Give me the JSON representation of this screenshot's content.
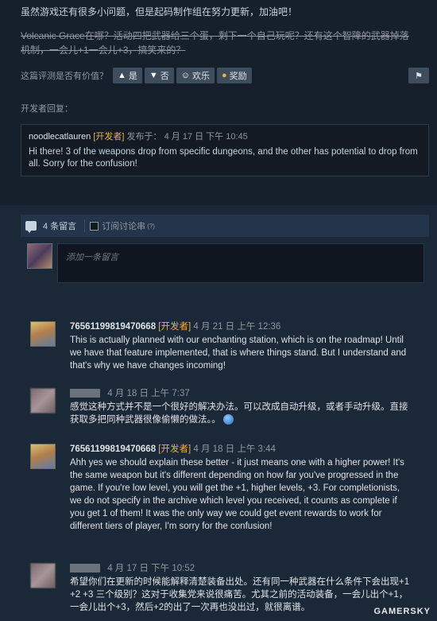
{
  "review": {
    "line1": "虽然游戏还有很多小问题，但是起码制作组在努力更新，加油吧！",
    "line2": "Volcanic Grace在哪？活动四把武器给三个蛋，剩下一个自己玩呢？还有这个智障的武器掉落机制，一会儿+1一会儿+3，搞笑来的？",
    "helpful_question": "这篇评测是否有价值？",
    "yes_label": "是",
    "no_label": "否",
    "funny_label": "欢乐",
    "award_label": "奖励"
  },
  "developer_response": {
    "label": "开发者回复：",
    "author": "noodlecatlauren",
    "tag": "[开发者]",
    "date": "发布于： 4 月 17 日 下午 10:45",
    "text": "Hi there! 3 of the weapons drop from specific dungeons, and the other has potential to drop from all. Sorry for the confusion!"
  },
  "comments_bar": {
    "count": "4 条留言",
    "subscribe": "订阅讨论串",
    "help": "(?)"
  },
  "comment_input": {
    "placeholder": "添加一条留言"
  },
  "comments": [
    {
      "author": "76561199819470668",
      "tag": "[开发者]",
      "time": "4 月 21 日 上午 12:36",
      "text": "This is actually planned with our enchanting station, which is on the roadmap! Until we have that feature implemented, that is where things stand. But I understand and that's why we have changes incoming!"
    },
    {
      "author": "",
      "tag": "",
      "time": "4 月 18 日 上午 7:37",
      "text": "感觉这种方式并不是一个很好的解决办法。可以改成自动升级，或者手动升级。直接获取多把同种武器很像偷懒的做法。。"
    },
    {
      "author": "76561199819470668",
      "tag": "[开发者]",
      "time": "4 月 18 日 上午 3:44",
      "text": "Ahh yes we should explain these better - it just means one with a higher power! It's the same weapon but it's different depending on how far you've progressed in the game. If you're low level, you will get the +1, higher levels, +3. For completionists, we do not specify in the archive which level you received, it counts as complete if you get 1 of them! It was the only way we could get event rewards to work for different tiers of player, I'm sorry for the confusion!"
    },
    {
      "author": "",
      "tag": "",
      "time": "4 月 17 日 下午 10:52",
      "text": "希望你们在更新的时候能解释清楚装备出处。还有同一种武器在什么条件下会出现+1 +2 +3 三个级别？这对于收集党来说很痛苦。尤其之前的活动装备，一会儿出个+1，一会儿出个+3，然后+2的出了一次再也没出过，就很离谱。"
    }
  ],
  "watermark": "GAMERSKY"
}
